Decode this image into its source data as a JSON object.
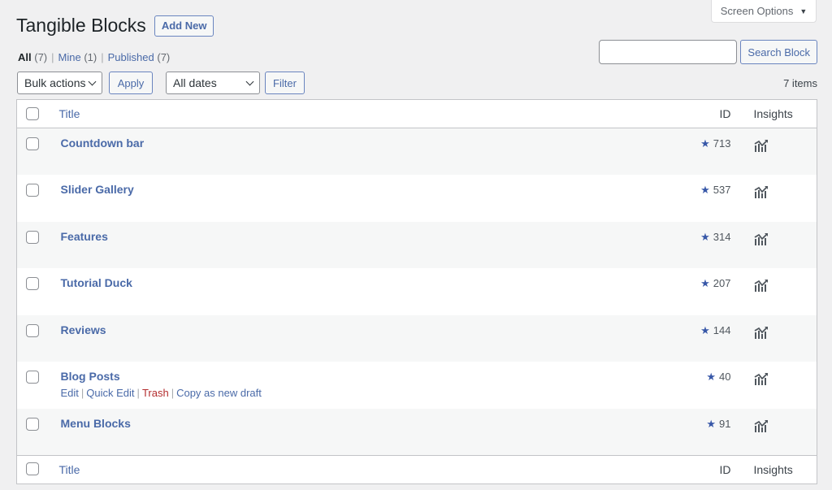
{
  "screen_options": {
    "label": "Screen Options",
    "arrow": "▼"
  },
  "header": {
    "title": "Tangible Blocks",
    "add_new": "Add New"
  },
  "views": [
    {
      "label": "All",
      "count": "(7)",
      "current": true
    },
    {
      "label": "Mine",
      "count": "(1)",
      "current": false
    },
    {
      "label": "Published",
      "count": "(7)",
      "current": false
    }
  ],
  "search": {
    "value": "",
    "placeholder": "",
    "button": "Search Block"
  },
  "tablenav": {
    "bulk_actions": "Bulk actions",
    "apply": "Apply",
    "dates": "All dates",
    "filter": "Filter",
    "items_count": "7 items"
  },
  "table": {
    "columns": {
      "title": "Title",
      "id": "ID",
      "insights": "Insights"
    },
    "rows": [
      {
        "title": "Countdown bar",
        "id": "713"
      },
      {
        "title": "Slider Gallery",
        "id": "537"
      },
      {
        "title": "Features",
        "id": "314"
      },
      {
        "title": "Tutorial Duck",
        "id": "207"
      },
      {
        "title": "Reviews",
        "id": "144"
      },
      {
        "title": "Blog Posts",
        "id": "40",
        "actions": [
          "Edit",
          "Quick Edit",
          "Trash",
          "Copy as new draft"
        ]
      },
      {
        "title": "Menu Blocks",
        "id": "91"
      }
    ]
  },
  "icons": {
    "star": "★",
    "insights": "chart-line-bars-icon"
  },
  "colors": {
    "link": "#4a6aa8",
    "trash": "#b32d2e",
    "star": "#3858a8",
    "background": "#f0f0f1"
  }
}
